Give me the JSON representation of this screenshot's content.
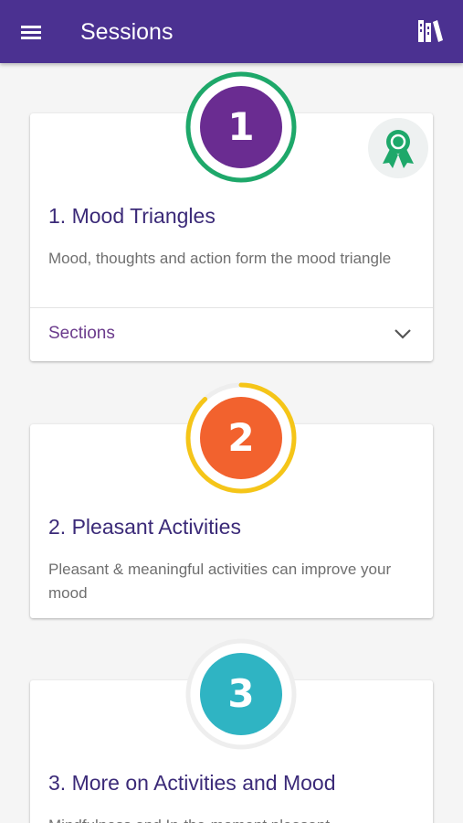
{
  "appbar": {
    "title": "Sessions",
    "menu_icon": "hamburger-menu-icon",
    "library_icon": "library-books-icon",
    "background": "#4b3191"
  },
  "sessions": [
    {
      "number": "1",
      "title": "1. Mood Triangles",
      "description": "Mood, thoughts and action form the mood triangle",
      "sections_label": "Sections",
      "circle_color": "#6a2c91",
      "ring_color": "#1ea86a",
      "progress": 1.0,
      "award_icon": "award-ribbon-icon",
      "award_color": "#1ea86a"
    },
    {
      "number": "2",
      "title": "2. Pleasant Activities",
      "description": "Pleasant & meaningful activities can improve your mood",
      "circle_color": "#f2622e",
      "ring_color": "#f5c518",
      "progress": 0.88
    },
    {
      "number": "3",
      "title": "3. More on Activities and Mood",
      "description": "Mindfulness and In-the-moment pleasant",
      "circle_color": "#2fb4c3",
      "ring_color": "#e6e6e6",
      "progress": 0
    }
  ]
}
